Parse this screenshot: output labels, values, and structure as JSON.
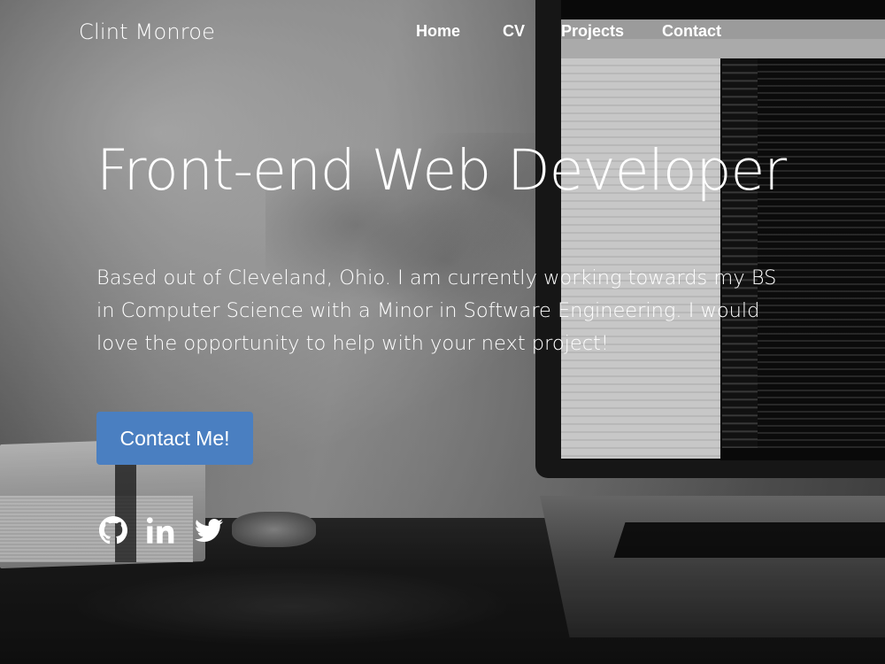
{
  "navbar": {
    "brand": "Clint Monroe",
    "links": [
      {
        "label": "Home"
      },
      {
        "label": "CV"
      },
      {
        "label": "Projects"
      },
      {
        "label": "Contact"
      }
    ]
  },
  "hero": {
    "title": "Front-end Web Developer",
    "description": "Based out of Cleveland, Ohio. I am currently working towards my BS in Computer Science with a Minor in Software Engineering. I would love the opportunity to help with your next project!",
    "cta_label": "Contact Me!",
    "cta_color": "#4a7fc1"
  },
  "social": [
    {
      "icon": "github-icon"
    },
    {
      "icon": "linkedin-icon"
    },
    {
      "icon": "twitter-icon"
    }
  ]
}
